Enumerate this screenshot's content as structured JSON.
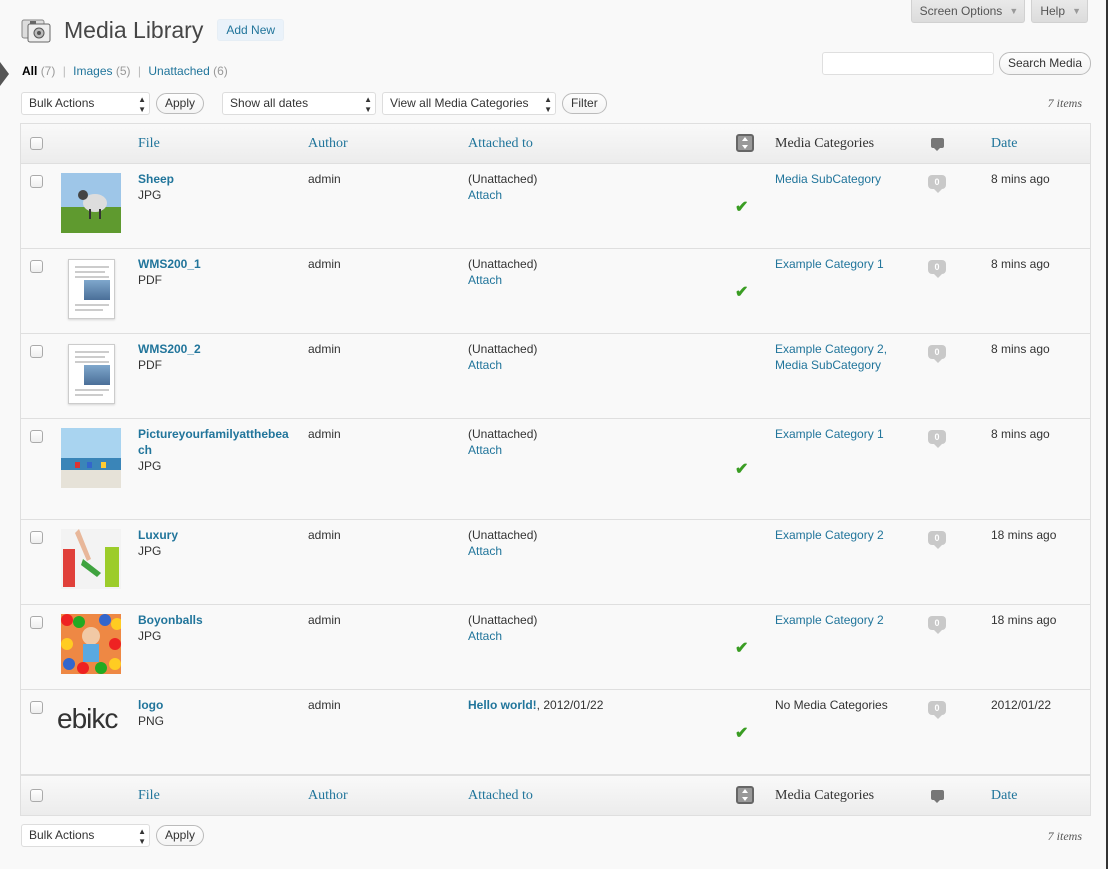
{
  "screen_meta": {
    "screen_options": "Screen Options",
    "help": "Help"
  },
  "header": {
    "title": "Media Library",
    "add_new": "Add New"
  },
  "views": {
    "all": "All",
    "all_count": "(7)",
    "images": "Images",
    "images_count": "(5)",
    "unattached": "Unattached",
    "unattached_count": "(6)",
    "separator": "|"
  },
  "search": {
    "button": "Search Media",
    "value": ""
  },
  "tablenav_top": {
    "bulk_actions": "Bulk Actions",
    "apply": "Apply",
    "dates": "Show all dates",
    "categories": "View all Media Categories",
    "filter": "Filter",
    "items": "7 items"
  },
  "tablenav_bottom": {
    "bulk_actions": "Bulk Actions",
    "apply": "Apply",
    "items": "7 items"
  },
  "columns": {
    "file": "File",
    "author": "Author",
    "attached_to": "Attached to",
    "media_categories": "Media Categories",
    "date": "Date"
  },
  "rows": [
    {
      "title": "Sheep",
      "type": "JPG",
      "author": "admin",
      "attached": "(Unattached)",
      "attach": "Attach",
      "cat1": "Media SubCategory",
      "cat2": "",
      "comments": "0",
      "date": "8 mins ago",
      "synced": true,
      "thumb": "sheep"
    },
    {
      "title": "WMS200_1",
      "type": "PDF",
      "author": "admin",
      "attached": "(Unattached)",
      "attach": "Attach",
      "cat1": "Example Category 1",
      "cat2": "",
      "comments": "0",
      "date": "8 mins ago",
      "synced": true,
      "thumb": "doc"
    },
    {
      "title": "WMS200_2",
      "type": "PDF",
      "author": "admin",
      "attached": "(Unattached)",
      "attach": "Attach",
      "cat1": "Example Category 2,",
      "cat2": "Media SubCategory",
      "comments": "0",
      "date": "8 mins ago",
      "synced": false,
      "thumb": "doc"
    },
    {
      "title1": "Pictureyourfamilyatthebea",
      "title2": "ch",
      "type": "JPG",
      "author": "admin",
      "attached": "(Unattached)",
      "attach": "Attach",
      "cat1": "Example Category 1",
      "cat2": "",
      "comments": "0",
      "date": "8 mins ago",
      "synced": true,
      "thumb": "beach"
    },
    {
      "title": "Luxury",
      "type": "JPG",
      "author": "admin",
      "attached": "(Unattached)",
      "attach": "Attach",
      "cat1": "Example Category 2",
      "cat2": "",
      "comments": "0",
      "date": "18 mins ago",
      "synced": false,
      "thumb": "luxury"
    },
    {
      "title": "Boyonballs",
      "type": "JPG",
      "author": "admin",
      "attached": "(Unattached)",
      "attach": "Attach",
      "cat1": "Example Category 2",
      "cat2": "",
      "comments": "0",
      "date": "18 mins ago",
      "synced": true,
      "thumb": "balls"
    },
    {
      "title": "logo",
      "type": "PNG",
      "author": "admin",
      "attached_link": "Hello world!",
      "attached_date": ", 2012/01/22",
      "cat1": "No Media Categories",
      "cat2": "",
      "comments": "0",
      "date": "2012/01/22",
      "synced": true,
      "thumb": "logo",
      "logo_text": "ebikc"
    }
  ],
  "colors": {
    "link": "#21759b",
    "check": "#3a9d23",
    "bubble": "#c9c9c9"
  }
}
